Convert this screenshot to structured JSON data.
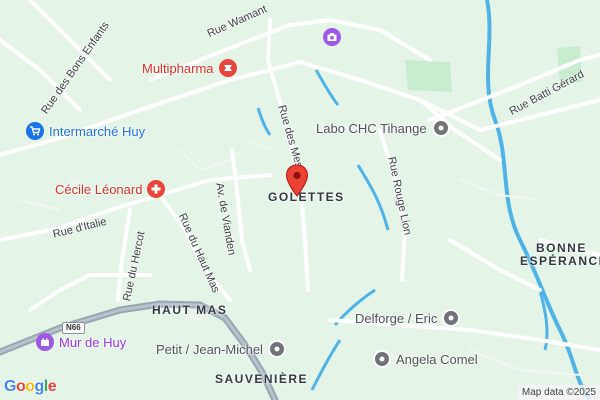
{
  "map": {
    "colors": {
      "land": "#e4f5e8",
      "road": "#ffffff",
      "minor_road": "#f3f6f4",
      "water": "#4fb3e8",
      "highway": "#9aa6b2",
      "park": "#c7ecd0",
      "marker": "#ea4335"
    },
    "roads": [
      {
        "name": "Rue Wamant"
      },
      {
        "name": "Rue des Bons Enfants"
      },
      {
        "name": "Rue des Mes"
      },
      {
        "name": "Rue Rouge Lion"
      },
      {
        "name": "Av. de Vianden"
      },
      {
        "name": "Rue d'Italie"
      },
      {
        "name": "Rue du Hercot"
      },
      {
        "name": "Rue du Haut Mas"
      },
      {
        "name": "Rue Batti Gérard"
      }
    ],
    "areas": [
      {
        "name": "GOLETTES"
      },
      {
        "name": "HAUT MAS"
      },
      {
        "name": "SAUVENIÈRE"
      },
      {
        "name": "BONNE"
      },
      {
        "name": "ESPÉRANCE"
      }
    ],
    "pois": [
      {
        "name": "Multipharma",
        "icon": "pharmacy-icon"
      },
      {
        "name": "Intermarché Huy",
        "icon": "shopping-cart-icon"
      },
      {
        "name": "Cécile Léonard",
        "icon": "medical-cross-icon"
      },
      {
        "name": "Labo CHC Tihange",
        "icon": "place-pin-icon"
      },
      {
        "name": "Delforge / Eric",
        "icon": "place-pin-icon"
      },
      {
        "name": "Petit / Jean-Michel",
        "icon": "place-pin-icon"
      },
      {
        "name": "Angela Comel",
        "icon": "place-pin-icon"
      },
      {
        "name": "Mur de Huy",
        "icon": "landmark-icon"
      },
      {
        "name": "",
        "icon": "camera-icon"
      }
    ],
    "highway_shield": "N66",
    "selected_marker": {
      "icon": "red-location-pin-icon"
    },
    "logo": {
      "letters": [
        "G",
        "o",
        "o",
        "g",
        "l",
        "e"
      ]
    },
    "attribution": "Map data ©2025"
  }
}
